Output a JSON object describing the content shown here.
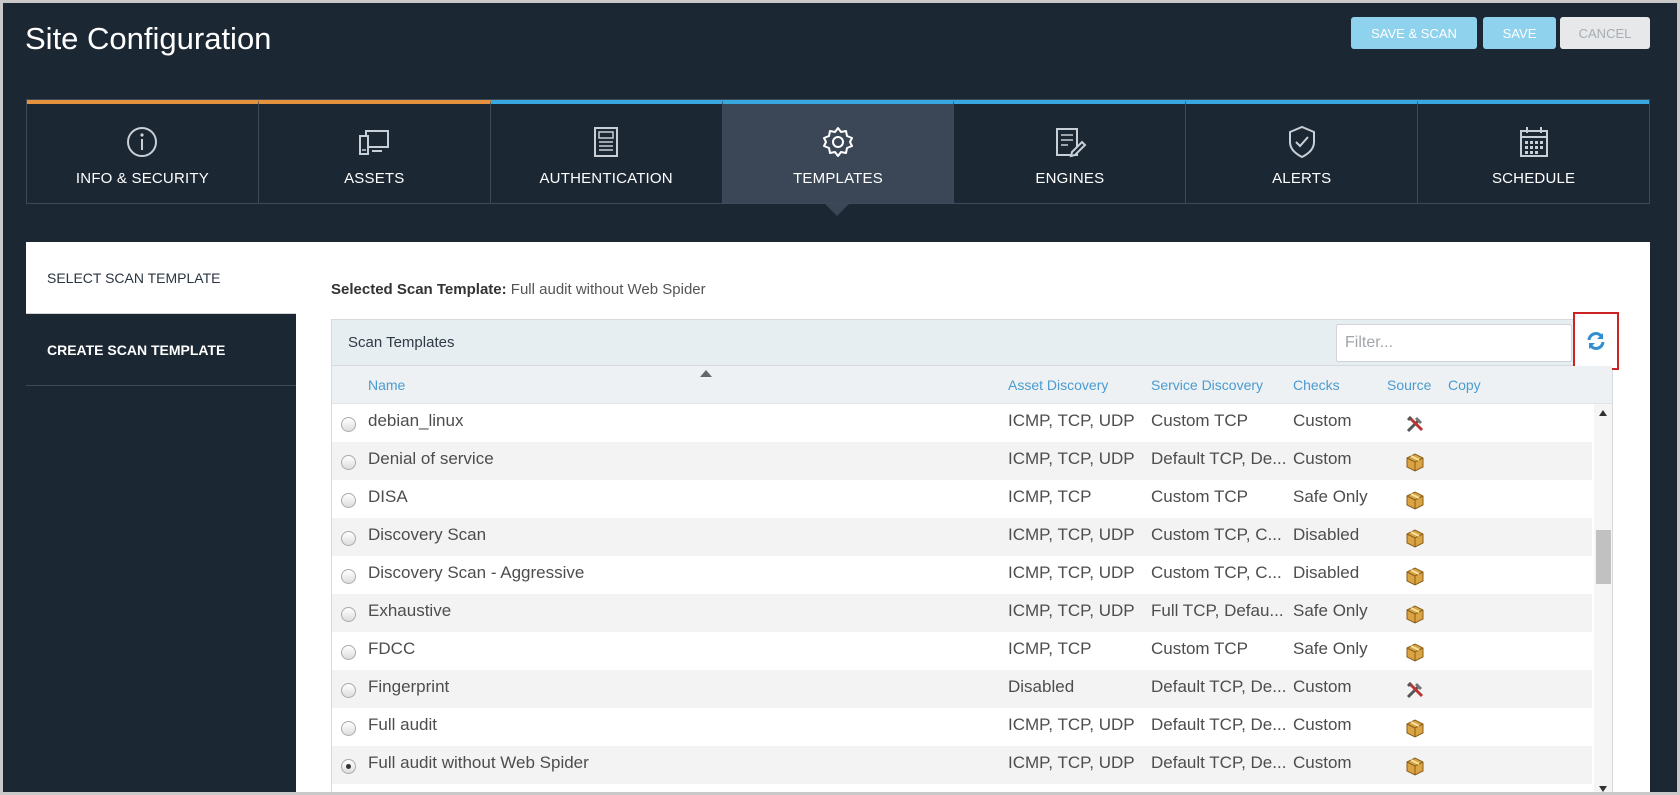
{
  "header": {
    "title": "Site Configuration",
    "buttons": {
      "save_scan": "SAVE & SCAN",
      "save": "SAVE",
      "cancel": "CANCEL"
    }
  },
  "tabs": [
    {
      "label": "INFO & SECURITY",
      "icon": "info-icon"
    },
    {
      "label": "ASSETS",
      "icon": "assets-icon"
    },
    {
      "label": "AUTHENTICATION",
      "icon": "authentication-icon"
    },
    {
      "label": "TEMPLATES",
      "icon": "gear-icon"
    },
    {
      "label": "ENGINES",
      "icon": "engine-edit-icon"
    },
    {
      "label": "ALERTS",
      "icon": "shield-check-icon"
    },
    {
      "label": "SCHEDULE",
      "icon": "calendar-icon"
    }
  ],
  "active_tab": "TEMPLATES",
  "sidebar": {
    "items": [
      {
        "label": "SELECT SCAN TEMPLATE"
      },
      {
        "label": "CREATE SCAN TEMPLATE"
      }
    ]
  },
  "selected": {
    "label": "Selected Scan Template:",
    "value": "Full audit without Web Spider"
  },
  "grid": {
    "title": "Scan Templates",
    "filter_placeholder": "Filter...",
    "columns": {
      "name": "Name",
      "asset": "Asset Discovery",
      "service": "Service Discovery",
      "checks": "Checks",
      "source": "Source",
      "copy": "Copy"
    },
    "rows": [
      {
        "name": "debian_linux",
        "asset": "ICMP, TCP, UDP",
        "service": "Custom TCP",
        "checks": "Custom",
        "source": "tools-icon",
        "selected": false
      },
      {
        "name": "Denial of service",
        "asset": "ICMP, TCP, UDP",
        "service": "Default TCP, De...",
        "checks": "Custom",
        "source": "package-icon",
        "selected": false
      },
      {
        "name": "DISA",
        "asset": "ICMP, TCP",
        "service": "Custom TCP",
        "checks": "Safe Only",
        "source": "package-icon",
        "selected": false
      },
      {
        "name": "Discovery Scan",
        "asset": "ICMP, TCP, UDP",
        "service": "Custom TCP, C...",
        "checks": "Disabled",
        "source": "package-icon",
        "selected": false
      },
      {
        "name": "Discovery Scan - Aggressive",
        "asset": "ICMP, TCP, UDP",
        "service": "Custom TCP, C...",
        "checks": "Disabled",
        "source": "package-icon",
        "selected": false
      },
      {
        "name": "Exhaustive",
        "asset": "ICMP, TCP, UDP",
        "service": "Full TCP, Defau...",
        "checks": "Safe Only",
        "source": "package-icon",
        "selected": false
      },
      {
        "name": "FDCC",
        "asset": "ICMP, TCP",
        "service": "Custom TCP",
        "checks": "Safe Only",
        "source": "package-icon",
        "selected": false
      },
      {
        "name": "Fingerprint",
        "asset": "Disabled",
        "service": "Default TCP, De...",
        "checks": "Custom",
        "source": "tools-icon",
        "selected": false
      },
      {
        "name": "Full audit",
        "asset": "ICMP, TCP, UDP",
        "service": "Default TCP, De...",
        "checks": "Custom",
        "source": "package-icon",
        "selected": false
      },
      {
        "name": "Full audit without Web Spider",
        "asset": "ICMP, TCP, UDP",
        "service": "Default TCP, De...",
        "checks": "Custom",
        "source": "package-icon",
        "selected": true
      }
    ]
  }
}
